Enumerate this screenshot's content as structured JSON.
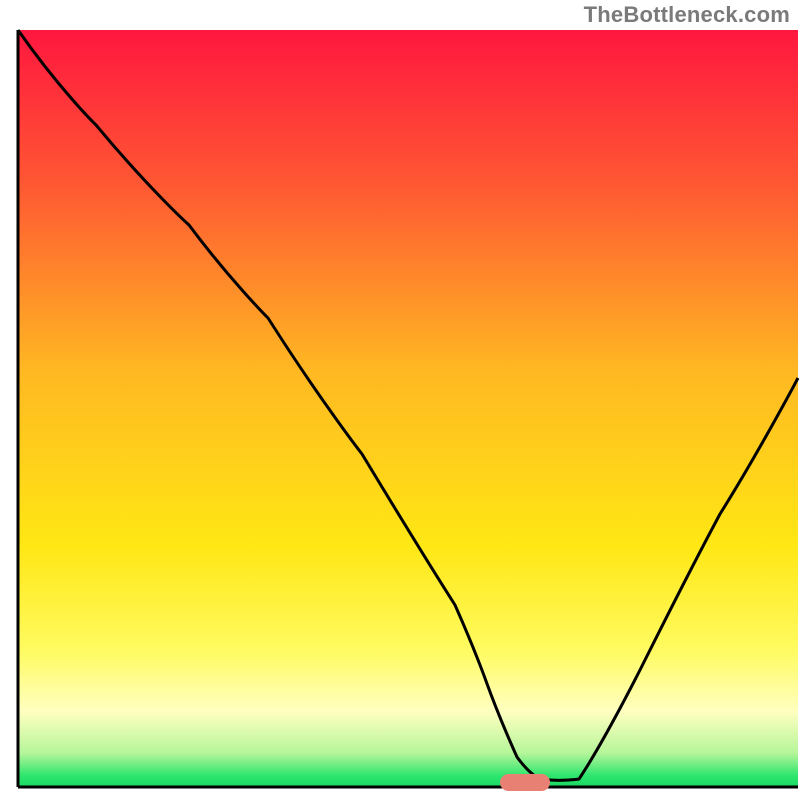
{
  "watermark": {
    "text": "TheBottleneck.com"
  },
  "chart_data": {
    "type": "line",
    "title": "",
    "xlabel": "",
    "ylabel": "",
    "xlim": [
      0,
      100
    ],
    "ylim": [
      0,
      100
    ],
    "legend": false,
    "grid": false,
    "background_gradient": {
      "stops": [
        {
          "offset": 0.0,
          "color": "#ff173f"
        },
        {
          "offset": 0.2,
          "color": "#ff5633"
        },
        {
          "offset": 0.45,
          "color": "#ffb822"
        },
        {
          "offset": 0.68,
          "color": "#ffe714"
        },
        {
          "offset": 0.82,
          "color": "#fffb61"
        },
        {
          "offset": 0.9,
          "color": "#ffffc0"
        },
        {
          "offset": 0.955,
          "color": "#b6f59a"
        },
        {
          "offset": 0.985,
          "color": "#2ee66e"
        },
        {
          "offset": 1.0,
          "color": "#16d964"
        }
      ]
    },
    "series": [
      {
        "name": "bottleneck-curve",
        "x": [
          0,
          10,
          22,
          32,
          44,
          56,
          60,
          64,
          67,
          72,
          80,
          90,
          100
        ],
        "y": [
          100,
          88,
          74,
          62,
          44,
          24,
          14,
          4,
          1,
          1,
          16,
          36,
          54
        ]
      }
    ],
    "marker": {
      "name": "optimum-marker",
      "x": 65,
      "y": 1,
      "color": "#e98074",
      "shape": "rounded-bar"
    },
    "axes": {
      "left": {
        "visible": true,
        "ticks": false
      },
      "bottom": {
        "visible": true,
        "ticks": false
      },
      "right": {
        "visible": false
      },
      "top": {
        "visible": false
      }
    }
  }
}
